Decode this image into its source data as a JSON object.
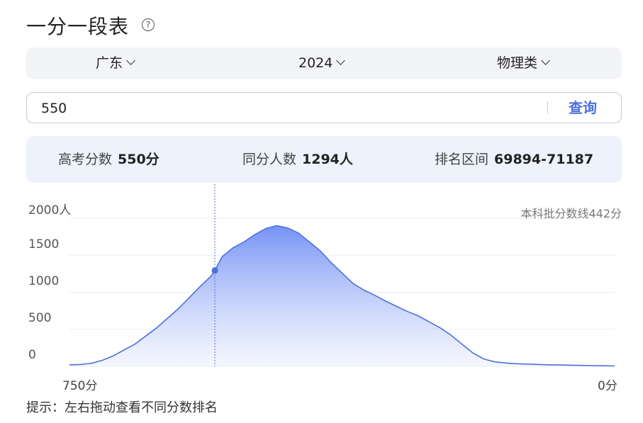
{
  "title": "一分一段表",
  "help_icon": "?",
  "filters": {
    "province": "广东",
    "year": "2024",
    "category": "物理类"
  },
  "search": {
    "value": "550",
    "button": "查询"
  },
  "stats": {
    "score_label": "高考分数",
    "score_value": "550分",
    "count_label": "同分人数",
    "count_value": "1294人",
    "rank_label": "排名区间",
    "rank_value": "69894-71187"
  },
  "cutoff_label": "本科批分数线442分",
  "hint": "提示：左右拖动查看不同分数排名",
  "chart_data": {
    "type": "area",
    "x_label_left": "750分",
    "x_label_right": "0分",
    "y_ticks": [
      "2000人",
      "1500",
      "1000",
      "500",
      "0"
    ],
    "ylim": [
      0,
      2000
    ],
    "x_range": [
      750,
      0
    ],
    "selected_score": 550,
    "selected_count": 1294,
    "accent_color": "#4f6fe0",
    "x": [
      750,
      735,
      720,
      705,
      690,
      675,
      660,
      645,
      630,
      615,
      600,
      585,
      570,
      555,
      550,
      540,
      525,
      510,
      495,
      480,
      465,
      450,
      435,
      420,
      405,
      390,
      375,
      360,
      345,
      330,
      315,
      300,
      285,
      270,
      255,
      240,
      225,
      210,
      195,
      180,
      165,
      150,
      135,
      120,
      105,
      90,
      75,
      60,
      45,
      30,
      15,
      0
    ],
    "values": [
      20,
      25,
      40,
      80,
      140,
      220,
      300,
      410,
      520,
      650,
      780,
      930,
      1080,
      1220,
      1294,
      1480,
      1600,
      1680,
      1780,
      1860,
      1900,
      1870,
      1800,
      1680,
      1560,
      1400,
      1260,
      1120,
      1030,
      960,
      880,
      810,
      740,
      680,
      600,
      520,
      420,
      300,
      180,
      100,
      60,
      45,
      35,
      30,
      25,
      20,
      18,
      15,
      12,
      10,
      8,
      5
    ]
  }
}
